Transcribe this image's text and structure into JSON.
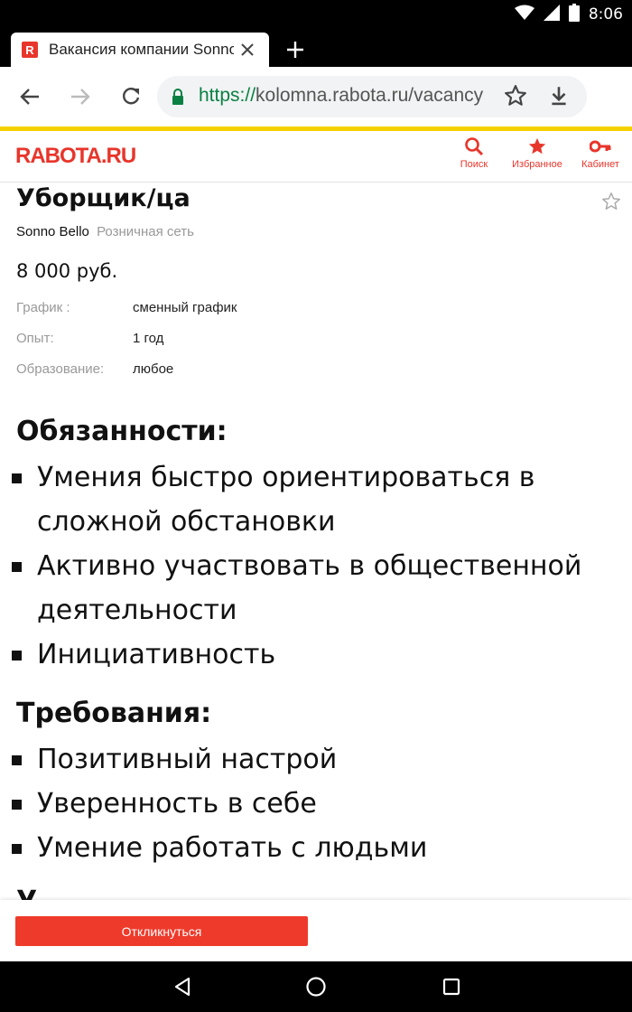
{
  "status_bar": {
    "time": "8:06",
    "icons": [
      "wifi-icon",
      "signal-icon",
      "battery-icon"
    ]
  },
  "browser": {
    "tab_title": "Вакансия компании Sonno Bello",
    "tab_favicon": "R",
    "url_scheme": "https://",
    "url_rest": "kolomna.rabota.ru/vacancy",
    "icons": [
      "back-icon",
      "forward-icon",
      "reload-icon",
      "lock-icon",
      "bookmark-star-icon",
      "download-icon",
      "close-icon",
      "plus-icon"
    ]
  },
  "site": {
    "logo": "RABOTA.RU",
    "nav": {
      "search": "Поиск",
      "favorites": "Избранное",
      "cabinet": "Кабинет"
    }
  },
  "vacancy": {
    "title": "Уборщик/ца",
    "company": "Sonno Bello",
    "company_type": "Розничная сеть",
    "salary": "8 000 руб.",
    "details": [
      {
        "label": "График :",
        "value": "сменный график"
      },
      {
        "label": "Опыт:",
        "value": "1 год"
      },
      {
        "label": "Образование:",
        "value": "любое"
      }
    ],
    "duties_title": "Обязанности:",
    "duties": [
      "Умения быстро ориентироваться в сложной обстановки",
      "Активно участвовать в общественной деятельности",
      "Инициативность"
    ],
    "requirements_title": "Требования:",
    "requirements": [
      "Позитивный настрой",
      "Уверенность в себе",
      "Умение работать с людьми"
    ],
    "next_heading_partial": "У"
  },
  "apply_button": "Откликнуться",
  "colors": {
    "brand_red": "#e8352b",
    "button_red": "#ee3a2b",
    "accent_yellow": "#f5d100",
    "secure_green": "#0b8043"
  }
}
